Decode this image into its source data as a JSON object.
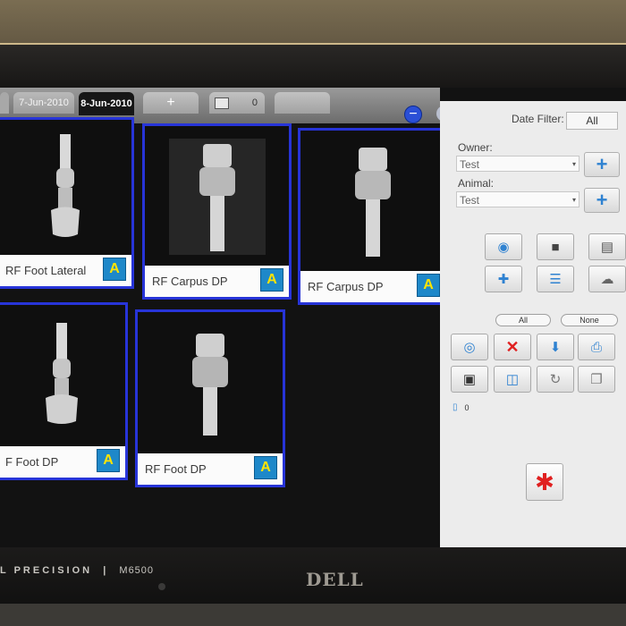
{
  "hardware": {
    "model_brand": "L PRECISION",
    "model_number": "M6500",
    "maker_logo": "DELL"
  },
  "tabs": {
    "date_old_label": "7-Jun-2010",
    "date_active_label": "8-Jun-2010",
    "add_label": "+",
    "count_label": "0"
  },
  "toolbar_icons": {
    "zoom_out": "minus-circle-icon",
    "zoom_in": "plus-circle-icon"
  },
  "thumbnails": [
    {
      "caption": "RF Foot Lateral"
    },
    {
      "caption": "RF Carpus DP"
    },
    {
      "caption": "RF Carpus DP"
    },
    {
      "caption": "F Foot DP"
    },
    {
      "caption": "RF Foot DP"
    }
  ],
  "annotate_glyph": "A",
  "panel": {
    "date_filter_label": "Date Filter:",
    "date_filter_value": "All",
    "owner_label": "Owner:",
    "owner_value": "Test",
    "animal_label": "Animal:",
    "animal_value": "Test",
    "all_label": "All",
    "none_label": "None",
    "item_count": "0"
  },
  "colors": {
    "thumb_border": "#2734d8",
    "panel_bg": "#ececec",
    "accent_blue": "#2f82d1",
    "delete_red": "#e02020"
  }
}
